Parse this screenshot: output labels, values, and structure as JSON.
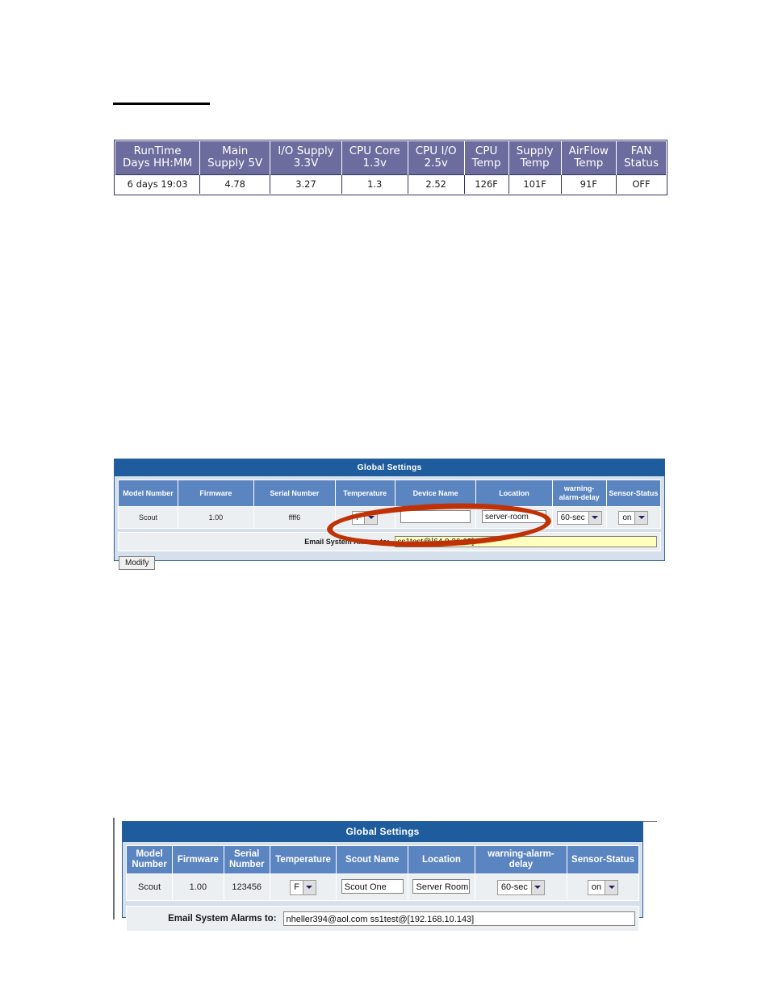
{
  "status_table": {
    "name": "system-status-table",
    "columns": [
      {
        "line1": "RunTime",
        "line2": "Days HH:MM"
      },
      {
        "line1": "Main",
        "line2": "Supply 5V"
      },
      {
        "line1": "I/O Supply",
        "line2": "3.3V"
      },
      {
        "line1": "CPU Core",
        "line2": "1.3v"
      },
      {
        "line1": "CPU I/O",
        "line2": "2.5v"
      },
      {
        "line1": "CPU",
        "line2": "Temp"
      },
      {
        "line1": "Supply",
        "line2": "Temp"
      },
      {
        "line1": "AirFlow",
        "line2": "Temp"
      },
      {
        "line1": "FAN",
        "line2": "Status"
      }
    ],
    "values": [
      "6 days 19:03",
      "4.78",
      "3.27",
      "1.3",
      "2.52",
      "126F",
      "101F",
      "91F",
      "OFF"
    ],
    "header_color": "#6c6c9e",
    "border_color": "#333366"
  },
  "panel_middle": {
    "title": "Global Settings",
    "columns": [
      "Model Number",
      "Firmware",
      "Serial Number",
      "Temperature",
      "Device Name",
      "Location",
      "warning-alarm-delay",
      "Sensor-Status"
    ],
    "row": {
      "model_number": "Scout",
      "firmware": "1.00",
      "serial_number": "ffff6",
      "temperature_unit": "F",
      "device_name": "",
      "location": "server-room",
      "warning_alarm_delay": "60-sec",
      "sensor_status": "on"
    },
    "email_label": "Email System Alarms to:",
    "email_value": "ss1test@[64.9.36.65]",
    "modify_label": "Modify",
    "annotation": {
      "shape": "ellipse",
      "color": "#c03205"
    }
  },
  "panel_bottom": {
    "title": "Global Settings",
    "columns": [
      {
        "line1": "Model",
        "line2": "Number"
      },
      {
        "line1": "Firmware",
        "line2": ""
      },
      {
        "line1": "Serial",
        "line2": "Number"
      },
      {
        "line1": "Temperature",
        "line2": ""
      },
      {
        "line1": "Scout Name",
        "line2": ""
      },
      {
        "line1": "Location",
        "line2": ""
      },
      {
        "line1": "warning-alarm-delay",
        "line2": ""
      },
      {
        "line1": "Sensor-Status",
        "line2": ""
      }
    ],
    "row": {
      "model_number": "Scout",
      "firmware": "1.00",
      "serial_number": "123456",
      "temperature_unit": "F",
      "scout_name": "Scout One",
      "location": "Server Room",
      "warning_alarm_delay": "60-sec",
      "sensor_status": "on"
    },
    "email_label": "Email System Alarms to:",
    "email_value": "nheller394@aol.com ss1test@[192.168.10.143]"
  },
  "colors": {
    "panel_title_blue": "#1f5c9e",
    "column_header_blue": "#5b85c0",
    "panel_bg": "#d6e0ec",
    "status_header_purple": "#6c6c9e",
    "annotation_red": "#c03205",
    "highlight_yellow": "#ffffbe"
  }
}
